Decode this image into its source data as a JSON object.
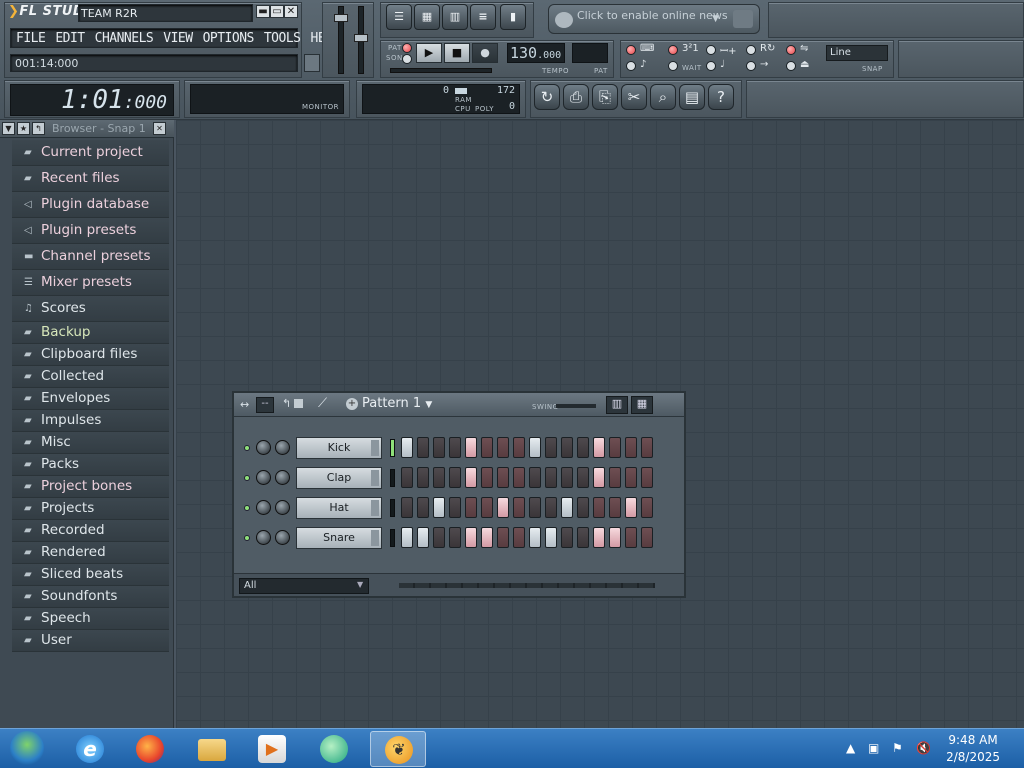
{
  "app": {
    "title": "TEAM R2R",
    "menu": [
      "FILE",
      "EDIT",
      "CHANNELS",
      "VIEW",
      "OPTIONS",
      "TOOLS",
      "HELP"
    ],
    "hint": "001:14:000",
    "time_main": "1:01",
    "time_ms": ":000",
    "tempo": "130",
    "tempo_frac": ".000",
    "tempo_label": "TEMPO",
    "pat_label": "PAT",
    "pat_mode": "PAT",
    "song_mode": "SONG",
    "monitor_label": "MONITOR",
    "ram_label": "RAM",
    "cpu_label": "CPU",
    "poly_label": "POLY",
    "cpu_val": "0",
    "ram_val": "172",
    "poly_val": "0",
    "news": "Click to enable online news",
    "snap": "Line",
    "snap_label": "SNAP",
    "wait_label": "WAIT"
  },
  "browser": {
    "title": "Browser - Snap 1",
    "items": [
      {
        "label": "Current project",
        "icon": "folder-icon",
        "style": "c-pink big"
      },
      {
        "label": "Recent files",
        "icon": "folder-icon",
        "style": "c-pink big"
      },
      {
        "label": "Plugin database",
        "icon": "plugin-icon",
        "style": "c-pink big"
      },
      {
        "label": "Plugin presets",
        "icon": "plugin-icon",
        "style": "c-pink big"
      },
      {
        "label": "Channel presets",
        "icon": "channel-icon",
        "style": "c-pink big"
      },
      {
        "label": "Mixer presets",
        "icon": "mixer-icon",
        "style": "c-pink big"
      },
      {
        "label": "Scores",
        "icon": "note-icon",
        "style": "big"
      },
      {
        "label": "Backup",
        "icon": "folder-icon",
        "style": "c-green"
      },
      {
        "label": "Clipboard files",
        "icon": "folder-icon",
        "style": ""
      },
      {
        "label": "Collected",
        "icon": "folder-icon",
        "style": ""
      },
      {
        "label": "Envelopes",
        "icon": "folder-icon",
        "style": ""
      },
      {
        "label": "Impulses",
        "icon": "folder-icon",
        "style": ""
      },
      {
        "label": "Misc",
        "icon": "folder-icon",
        "style": ""
      },
      {
        "label": "Packs",
        "icon": "folder-icon",
        "style": ""
      },
      {
        "label": "Project bones",
        "icon": "folder-icon",
        "style": "c-pink"
      },
      {
        "label": "Projects",
        "icon": "folder-icon",
        "style": ""
      },
      {
        "label": "Recorded",
        "icon": "folder-icon",
        "style": ""
      },
      {
        "label": "Rendered",
        "icon": "folder-icon",
        "style": ""
      },
      {
        "label": "Sliced beats",
        "icon": "folder-icon",
        "style": ""
      },
      {
        "label": "Soundfonts",
        "icon": "folder-icon",
        "style": ""
      },
      {
        "label": "Speech",
        "icon": "folder-icon",
        "style": ""
      },
      {
        "label": "User",
        "icon": "folder-icon",
        "style": ""
      }
    ]
  },
  "sequencer": {
    "title": "Pattern 1",
    "swing_label": "SWING",
    "filter": "All",
    "channels": [
      {
        "name": "Kick",
        "steps": [
          1,
          0,
          0,
          0,
          1,
          0,
          0,
          0,
          1,
          0,
          0,
          0,
          1,
          0,
          0,
          0
        ],
        "selected": true
      },
      {
        "name": "Clap",
        "steps": [
          0,
          0,
          0,
          0,
          1,
          0,
          0,
          0,
          0,
          0,
          0,
          0,
          1,
          0,
          0,
          0
        ],
        "selected": false
      },
      {
        "name": "Hat",
        "steps": [
          0,
          0,
          1,
          0,
          0,
          0,
          1,
          0,
          0,
          0,
          1,
          0,
          0,
          0,
          1,
          0
        ],
        "selected": false
      },
      {
        "name": "Snare",
        "steps": [
          1,
          1,
          0,
          0,
          1,
          1,
          0,
          0,
          1,
          1,
          0,
          0,
          1,
          1,
          0,
          0
        ],
        "selected": false
      }
    ]
  },
  "taskbar": {
    "time": "9:48 AM",
    "date": "2/8/2025",
    "apps": [
      "start-orb",
      "internet-explorer",
      "firefox",
      "file-explorer",
      "media-player",
      "messenger",
      "fl-studio"
    ]
  }
}
